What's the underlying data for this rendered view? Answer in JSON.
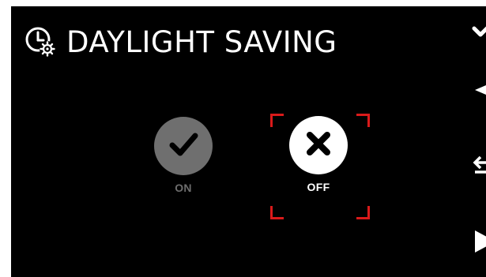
{
  "header": {
    "title": "DAYLIGHT SAVING",
    "icon": "clock-gear-icon"
  },
  "options": [
    {
      "label": "ON",
      "icon": "checkmark-icon",
      "selected": false
    },
    {
      "label": "OFF",
      "icon": "x-mark-icon",
      "selected": true
    }
  ],
  "side_controls": [
    {
      "icon": "checkmark-icon",
      "role": "confirm"
    },
    {
      "icon": "triangle-left-icon",
      "role": "back"
    },
    {
      "icon": "swap-arrows-icon",
      "role": "switch"
    },
    {
      "icon": "triangle-right-icon",
      "role": "next"
    }
  ],
  "colors": {
    "background": "#000000",
    "text": "#ffffff",
    "inactive": "#6f6f6f",
    "selection": "#d91a1a"
  }
}
